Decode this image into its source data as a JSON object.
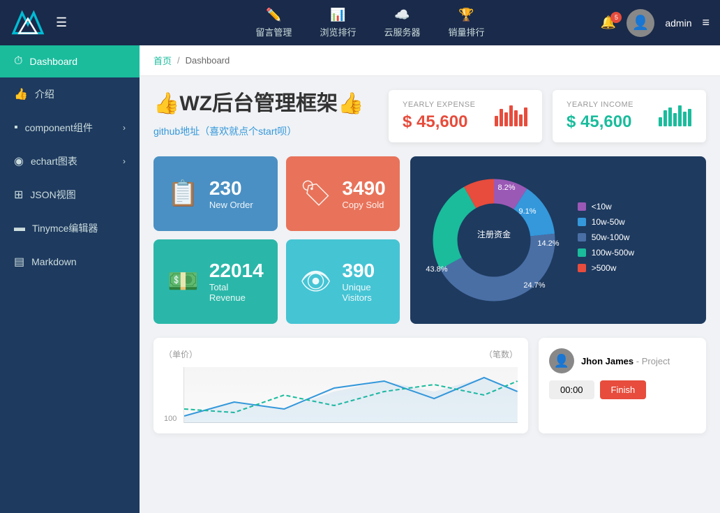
{
  "topNav": {
    "hamburger": "☰",
    "navItems": [
      {
        "id": "message",
        "icon": "✏️",
        "label": "留言管理"
      },
      {
        "id": "browse",
        "icon": "📊",
        "label": "浏览排行"
      },
      {
        "id": "cloud",
        "icon": "☁️",
        "label": "云服务器"
      },
      {
        "id": "sales",
        "icon": "🏆",
        "label": "销量排行"
      }
    ],
    "badge": "5",
    "adminLabel": "admin",
    "menuIcon": "≡"
  },
  "sidebar": {
    "items": [
      {
        "id": "dashboard",
        "icon": "⏱",
        "label": "Dashboard",
        "active": true
      },
      {
        "id": "intro",
        "icon": "👍",
        "label": "介绍",
        "active": false
      },
      {
        "id": "component",
        "icon": "▪",
        "label": "component组件",
        "arrow": true,
        "active": false
      },
      {
        "id": "echart",
        "icon": "◉",
        "label": "echart图表",
        "arrow": true,
        "active": false
      },
      {
        "id": "json",
        "icon": "⊞",
        "label": "JSON视图",
        "active": false
      },
      {
        "id": "tinymce",
        "icon": "▬",
        "label": "Tinymce编辑器",
        "active": false
      },
      {
        "id": "markdown",
        "icon": "▤",
        "label": "Markdown",
        "active": false
      }
    ]
  },
  "breadcrumb": {
    "home": "首页",
    "separator": "/",
    "current": "Dashboard"
  },
  "hero": {
    "title": "👍WZ后台管理框架👍",
    "link": "github地址（喜欢就点个start呗）"
  },
  "yearlyExpense": {
    "label": "YEARLY EXPENSE",
    "value": "$ 45,600"
  },
  "yearlyIncome": {
    "label": "YEARLY INCOME",
    "value": "$ 45,600"
  },
  "statsCards": [
    {
      "id": "new-order",
      "color": "blue",
      "icon": "📋",
      "number": "230",
      "label": "New Order"
    },
    {
      "id": "copy-sold",
      "color": "coral",
      "icon": "🏷",
      "number": "3490",
      "label": "Copy Sold"
    },
    {
      "id": "total-revenue",
      "color": "teal",
      "icon": "💵",
      "number": "22014",
      "label": "Total Revenue"
    },
    {
      "id": "unique-visitors",
      "color": "cyan",
      "icon": "👁",
      "number": "390",
      "label": "Unique Visitors"
    }
  ],
  "donutChart": {
    "title": "注册资金",
    "segments": [
      {
        "label": "<10w",
        "color": "#9b59b6",
        "value": 9.1,
        "pct": "9.1%"
      },
      {
        "label": "10w-50w",
        "color": "#3498db",
        "value": 14.2,
        "pct": "14.2%"
      },
      {
        "label": "50w-100w",
        "color": "#5b7fbd",
        "value": 43.8,
        "pct": "43.8%"
      },
      {
        "label": "100w-500w",
        "color": "#1abc9c",
        "value": 24.7,
        "pct": "24.7%"
      },
      {
        "label": ">500w",
        "color": "#e74c3c",
        "value": 8.2,
        "pct": "8.2%"
      }
    ]
  },
  "bottomChart": {
    "leftLabel": "（单价）",
    "rightLabel": "（笔数）",
    "yMax": "100"
  },
  "activity": {
    "name": "Jhon James",
    "role": "Project",
    "timer": "00:00",
    "finishLabel": "Finish"
  }
}
